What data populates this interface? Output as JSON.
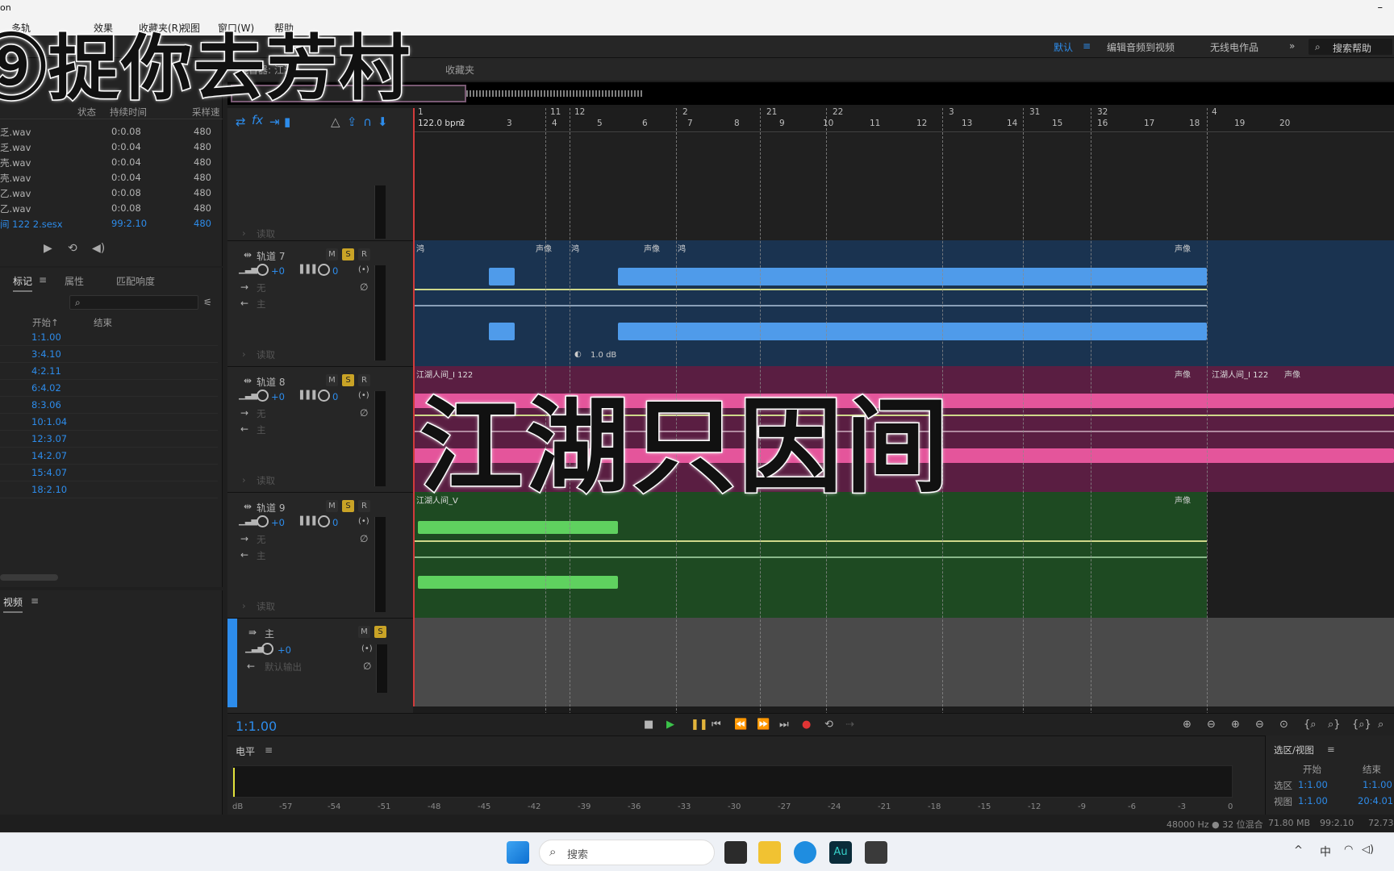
{
  "window": {
    "app_title": "on",
    "minimize": "–"
  },
  "menu": [
    "多轨",
    "效果",
    "收藏夹(R)",
    "视图",
    "窗口(W)",
    "帮助"
  ],
  "workspace": {
    "default": "默认",
    "edit_video": "编辑音频到视频",
    "radio": "无线电作品",
    "search_help": "搜索帮助"
  },
  "files": {
    "headers": {
      "status": "状态",
      "duration": "持续时间",
      "samplerate": "采样速"
    },
    "rows": [
      {
        "name": "乏.wav",
        "duration": "0:0.08",
        "rate": "480"
      },
      {
        "name": "乏.wav",
        "duration": "0:0.04",
        "rate": "480"
      },
      {
        "name": "壳.wav",
        "duration": "0:0.04",
        "rate": "480"
      },
      {
        "name": "壳.wav",
        "duration": "0:0.04",
        "rate": "480"
      },
      {
        "name": "乙.wav",
        "duration": "0:0.08",
        "rate": "480"
      },
      {
        "name": "乙.wav",
        "duration": "0:0.08",
        "rate": "480"
      },
      {
        "name": "间 122 2.sesx",
        "duration": "99:2.10",
        "rate": "480"
      }
    ]
  },
  "markers_panel": {
    "tabs": [
      "标记",
      "属性",
      "匹配响度"
    ],
    "headers": {
      "start": "开始↑",
      "end": "结束"
    },
    "rows": [
      "1:1.00",
      "3:4.10",
      "4:2.11",
      "6:4.02",
      "8:3.06",
      "10:1.04",
      "12:3.07",
      "14:2.07",
      "15:4.07",
      "18:2.10"
    ]
  },
  "video_panel": {
    "tab": "视频"
  },
  "editor": {
    "tabs": {
      "mixer": "混音器: 江湖人",
      "favorites": "收藏夹"
    },
    "tempo": "122.0 bpm",
    "ruler_bars": [
      "2",
      "3",
      "4",
      "5",
      "6",
      "7",
      "8",
      "9",
      "10",
      "11",
      "12",
      "13",
      "14",
      "15",
      "16",
      "17",
      "18",
      "19",
      "20"
    ],
    "ruler_markers": [
      "1",
      "11",
      "12",
      "2",
      "21",
      "22",
      "3",
      "31",
      "32",
      "4"
    ]
  },
  "tracks": [
    {
      "name": "",
      "read": "读取"
    },
    {
      "name": "轨道 7",
      "vol": "+0",
      "pan": "0",
      "input": "无",
      "output": "主",
      "read": "读取",
      "clip": "鸿",
      "pan_label": "声像",
      "gain": "1.0 dB",
      "color": "#1a3350",
      "wave": "#4f9bea"
    },
    {
      "name": "轨道 8",
      "vol": "+0",
      "pan": "0",
      "input": "无",
      "output": "主",
      "read": "读取",
      "clip": "江湖人间_I 122",
      "pan_label": "声像",
      "color": "#5a1e42",
      "wave": "#e4559b"
    },
    {
      "name": "轨道 9",
      "vol": "+0",
      "pan": "0",
      "input": "无",
      "output": "主",
      "read": "读取",
      "clip": "江湖人间_V",
      "pan_label": "声像",
      "color": "#1e4a22",
      "wave": "#5fd15f"
    },
    {
      "name": "主",
      "vol": "+0",
      "output": "默认输出"
    }
  ],
  "transport": {
    "time": "1:1.00"
  },
  "levels": {
    "title": "电平",
    "scale": [
      "dB",
      "-57",
      "-54",
      "-51",
      "-48",
      "-45",
      "-42",
      "-39",
      "-36",
      "-33",
      "-30",
      "-27",
      "-24",
      "-21",
      "-18",
      "-15",
      "-12",
      "-9",
      "-6",
      "-3",
      "0"
    ]
  },
  "selview": {
    "title": "选区/视图",
    "start": "开始",
    "end": "结束",
    "sel": "选区",
    "sel_start": "1:1.00",
    "sel_end": "1:1.00",
    "view": "视图",
    "view_start": "1:1.00",
    "view_end": "20:4.01"
  },
  "status": {
    "format": "48000 Hz ● 32 位混合",
    "size": "71.80 MB",
    "duration": "99:2.10",
    "free": "72.73"
  },
  "taskbar": {
    "search": "搜索",
    "ime": "中"
  },
  "captions": {
    "top": "⑨捉你去芳村",
    "center": "江湖只因间"
  }
}
